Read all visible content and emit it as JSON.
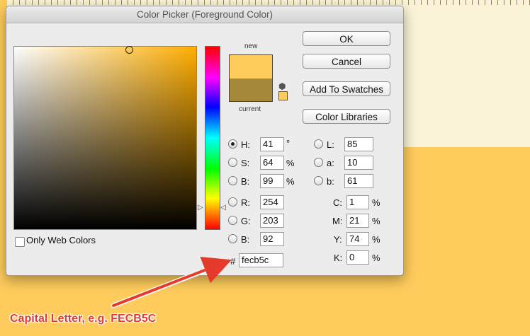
{
  "dialog": {
    "title": "Color Picker (Foreground Color)",
    "new_label": "new",
    "current_label": "current",
    "new_color": "#FECB5C",
    "current_color": "#A5893A",
    "buttons": {
      "ok": "OK",
      "cancel": "Cancel",
      "add_to_swatches": "Add To Swatches",
      "color_libraries": "Color Libraries"
    },
    "only_web_colors": "Only Web Colors",
    "hsb": {
      "h_label": "H:",
      "h_value": "41",
      "h_unit": "°",
      "s_label": "S:",
      "s_value": "64",
      "s_unit": "%",
      "b_label": "B:",
      "b_value": "99",
      "b_unit": "%"
    },
    "rgb": {
      "r_label": "R:",
      "r_value": "254",
      "g_label": "G:",
      "g_value": "203",
      "b_label": "B:",
      "b_value": "92"
    },
    "lab": {
      "l_label": "L:",
      "l_value": "85",
      "a_label": "a:",
      "a_value": "10",
      "b_label": "b:",
      "b_value": "61"
    },
    "cmyk": {
      "c_label": "C:",
      "c_value": "1",
      "m_label": "M:",
      "m_value": "21",
      "y_label": "Y:",
      "y_value": "74",
      "k_label": "K:",
      "k_value": "0",
      "unit": "%"
    },
    "hex_label": "#",
    "hex_value": "fecb5c"
  },
  "annotation": {
    "text": "Capital Letter, e.g. FECB5C",
    "color": "#E43B2C"
  }
}
